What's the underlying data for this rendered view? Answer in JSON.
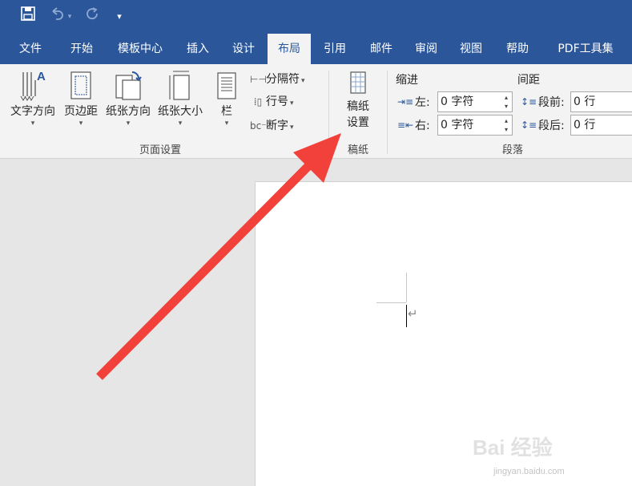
{
  "colors": {
    "title_bar": "#2b579a",
    "ribbon": "#f3f3f3",
    "workspace": "#e6e6e6",
    "page": "#ffffff",
    "arrow": "#f2403a"
  },
  "quick_access": {
    "save_icon": "save-icon",
    "undo_icon": "undo-icon",
    "redo_icon": "redo-icon",
    "customize_glyph": "▾"
  },
  "tabs": [
    {
      "label": "文件"
    },
    {
      "label": "开始"
    },
    {
      "label": "模板中心"
    },
    {
      "label": "插入"
    },
    {
      "label": "设计"
    },
    {
      "label": "布局",
      "active": true
    },
    {
      "label": "引用"
    },
    {
      "label": "邮件"
    },
    {
      "label": "审阅"
    },
    {
      "label": "视图"
    },
    {
      "label": "帮助"
    },
    {
      "label": "PDF工具集"
    }
  ],
  "page_setup": {
    "text_direction": "文字方向",
    "margins": "页边距",
    "orientation": "纸张方向",
    "size": "纸张大小",
    "columns": "栏",
    "breaks": "分隔符",
    "line_numbers": "行号",
    "hyphenation": "断字",
    "group_label": "页面设置"
  },
  "manuscript": {
    "btn_line1": "稿纸",
    "btn_line2": "设置",
    "group_label": "稿纸"
  },
  "paragraph": {
    "indent_header": "缩进",
    "spacing_header": "间距",
    "left_label": "左:",
    "left_value": "0 字符",
    "right_label": "右:",
    "right_value": "0 字符",
    "before_label": "段前:",
    "before_value": "0 行",
    "after_label": "段后:",
    "after_value": "0 行",
    "group_label": "段落"
  },
  "document": {
    "paragraph_mark": "↵"
  },
  "watermark": {
    "brand": "Bai 经验",
    "url": "jingyan.baidu.com"
  }
}
